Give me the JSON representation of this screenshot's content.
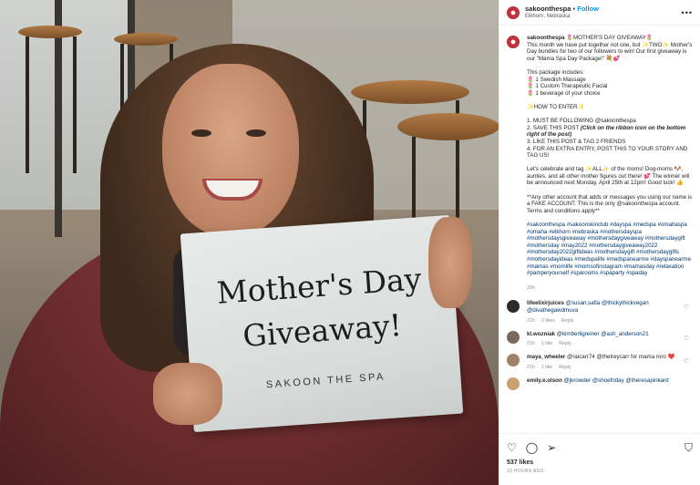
{
  "post": {
    "sign_line1": "Mother's Day",
    "sign_line2": "Giveaway!",
    "sign_sub": "SAKOON THE SPA"
  },
  "header": {
    "username": "sakoonthespa",
    "dot": "•",
    "follow": "Follow",
    "location": "Elkhorn, Nebraska",
    "more": "•••"
  },
  "caption": {
    "username": "sakoonthespa",
    "p1": " 🌷MOTHER'S DAY GIVEAWAY🌷\nThis month we have put together not one, but ✨TWO✨ Mother's Day bundles for two of our followers to win! Our first giveaway is our \"Mama Spa Day Package!\" 💐💕",
    "p2": "This package includes:\n🌷 1 Swedish Massage\n🌷 1 Custom Therapeutic Facial\n🌷 1 beverage of your choice",
    "p3": "✨HOW TO ENTER✨",
    "p4a": "1. MUST BE FOLLOWING @sakoonthespa\n2. SAVE THIS POST ",
    "p4b": "(Click on the ribbon icon on the bottom right of the post)",
    "p4c": "\n3. LIKE THIS POST & TAG 2 FRIENDS\n4. FOR AN EXTRA ENTRY, POST THIS TO YOUR STORY AND TAG US!",
    "p5": "Let's celebrate and tag ✨ALL✨ of the moms! Dog-moms 🐶, aunties, and all other mother figures out there! 💕 The winner will be announced next Monday, April 25th at 12pm! Good luck! 👍",
    "p6": "**Any other account that adds or messages you using our name is a FAKE ACCOUNT. This is the only @sakoonthespa account. Terms and conditions apply**",
    "hashtags": "#sakoonthespa #sakoonskinclub #dayspa #medspa #omahaspa #omaha #elkhorn #nebraska #mothersdayspa #mothersdaysgiveaway #mothersdaygiveaway #mothersdaygift #mothersday #may2022 #mothersdaygiveaway2022 #mothersday2022giftideas #mothersdaygift #mothersdaygifts #mothersdayideas #medspalife #medspanearme #dayspanearme #mamas #momlife #momsofinstagram #mamasday #relaxation #pamperyourself #sparooms #spaparty #spaday",
    "time": "20h"
  },
  "comments": [
    {
      "user": "lifeelixirjuices",
      "text": " @susan.safia @thickythickvegan @divathegawdmuva",
      "time": "21h",
      "likes": "2 likes",
      "reply": "Reply",
      "color": "#2c2c2c"
    },
    {
      "user": "kl.wozniak",
      "text": " @kimberligreiner @ash_anderson21",
      "time": "21h",
      "likes": "1 like",
      "reply": "Reply",
      "color": "#7a6a5e"
    },
    {
      "user": "maya_wheeler",
      "text": " @raicarr74 @thetreycarr for mama roro ❤️",
      "time": "21h",
      "likes": "1 like",
      "reply": "Reply",
      "color": "#a0826a"
    },
    {
      "user": "emily.e.olson",
      "text": " @jkrowder @shoefriday @theresapinkard",
      "time": "",
      "likes": "",
      "reply": "",
      "color": "#c9a070"
    }
  ],
  "actions": {
    "likes": "537 likes",
    "ago": "20 HOURS AGO"
  }
}
